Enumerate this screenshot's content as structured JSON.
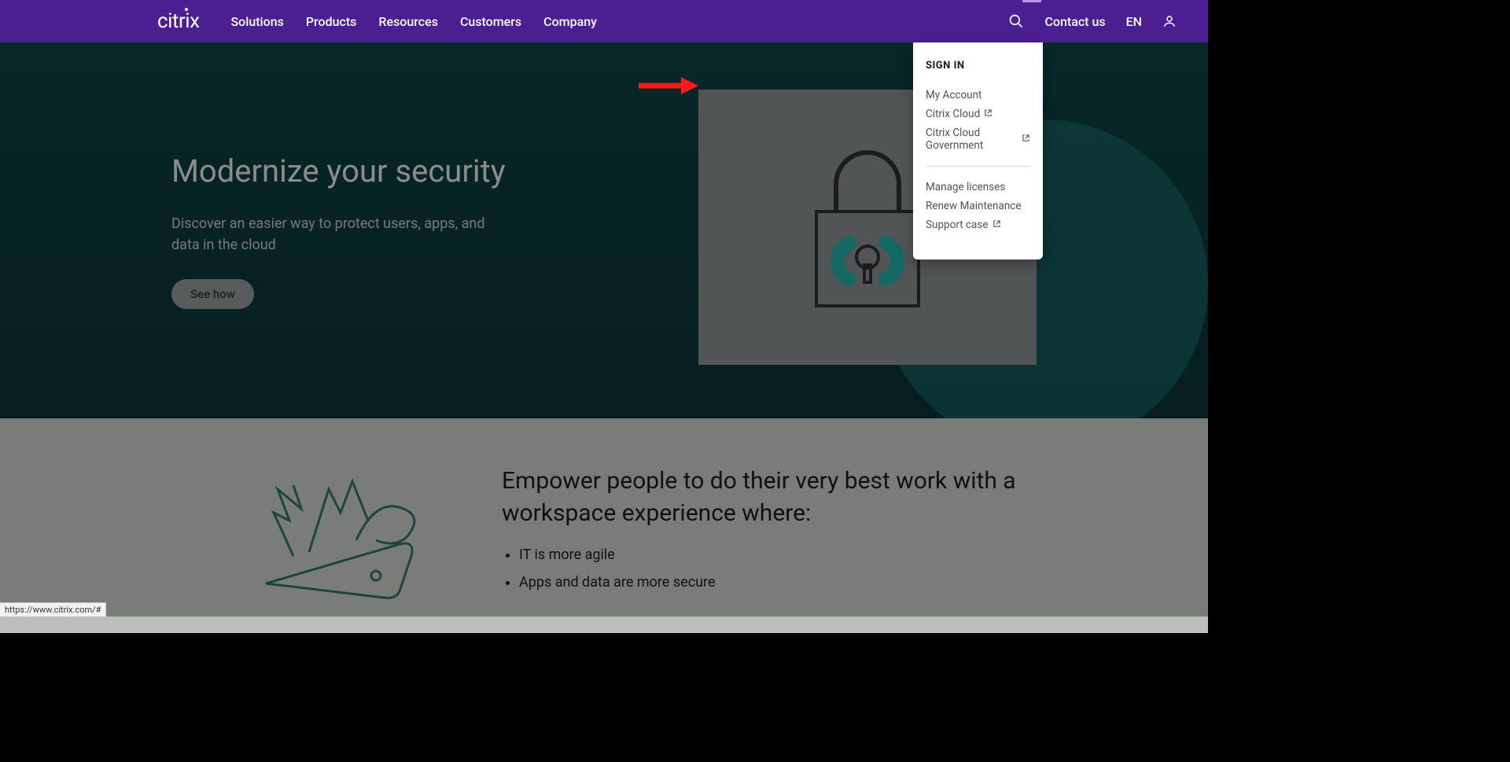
{
  "brand": "citrix",
  "nav": {
    "links": [
      "Solutions",
      "Products",
      "Resources",
      "Customers",
      "Company"
    ],
    "contact": "Contact us",
    "lang": "EN"
  },
  "hero": {
    "title": "Modernize your security",
    "subtitle": "Discover an easier way to protect users, apps, and data in the cloud",
    "cta": "See how"
  },
  "section2": {
    "title": "Empower people to do their very best work with a workspace experience where:",
    "items": [
      "IT is more agile",
      "Apps and data are more secure"
    ]
  },
  "dropdown": {
    "header": "SIGN IN",
    "group1": [
      {
        "label": "My Account",
        "external": false
      },
      {
        "label": "Citrix Cloud",
        "external": true
      },
      {
        "label": "Citrix Cloud Government",
        "external": true
      }
    ],
    "group2": [
      {
        "label": "Manage licenses",
        "external": false
      },
      {
        "label": "Renew Maintenance",
        "external": false
      },
      {
        "label": "Support case",
        "external": true
      }
    ]
  },
  "status_url": "https://www.citrix.com/#"
}
